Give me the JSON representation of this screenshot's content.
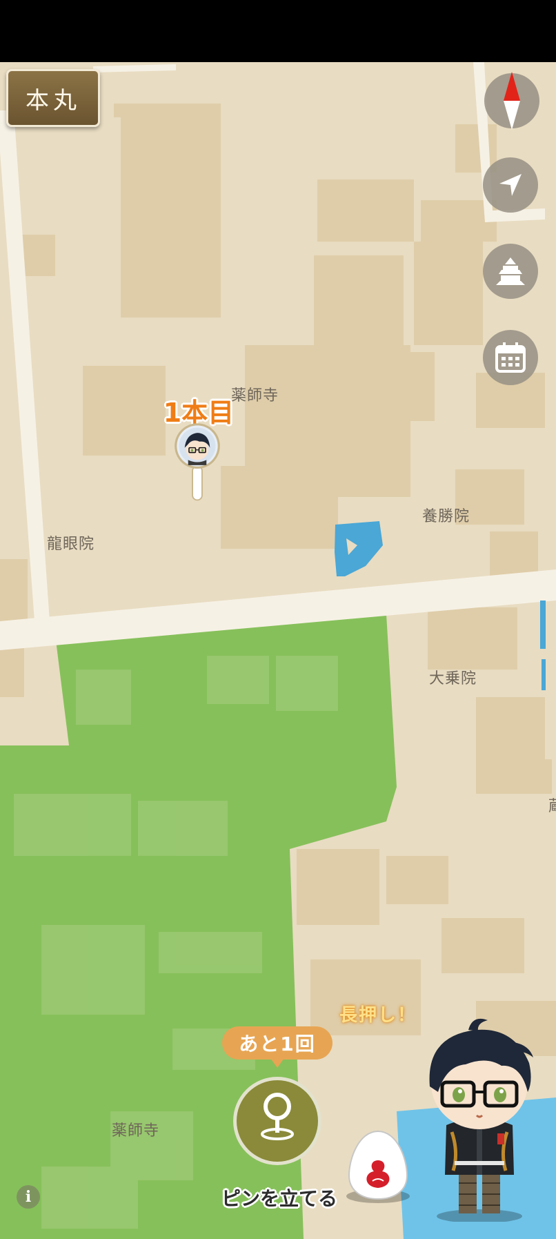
{
  "castle_button": {
    "label": "本丸"
  },
  "map": {
    "place_labels": {
      "yakushiji_top": "薬師寺",
      "yakushiji_bottom": "薬師寺",
      "ryuganin": "龍眼院",
      "yoshoin": "養勝院",
      "daijoin": "大乗院",
      "edge_partial": "蔵"
    }
  },
  "pin_marker": {
    "caption": "1本目"
  },
  "controls": {
    "compass": "compass-icon",
    "locate": "location-arrow-icon",
    "castle": "castle-icon",
    "calendar": "calendar-icon"
  },
  "bottom": {
    "remaining": "あと1回",
    "pin_button_label": "ピンを立てる",
    "long_press_hint": "長押し！",
    "info": "i"
  },
  "colors": {
    "ground": "#e8dcc2",
    "building": "#e0cfae",
    "road": "#f6f1e5",
    "park": "#86c05a",
    "water": "#4aa7d6",
    "accent": "#ef7d16"
  }
}
